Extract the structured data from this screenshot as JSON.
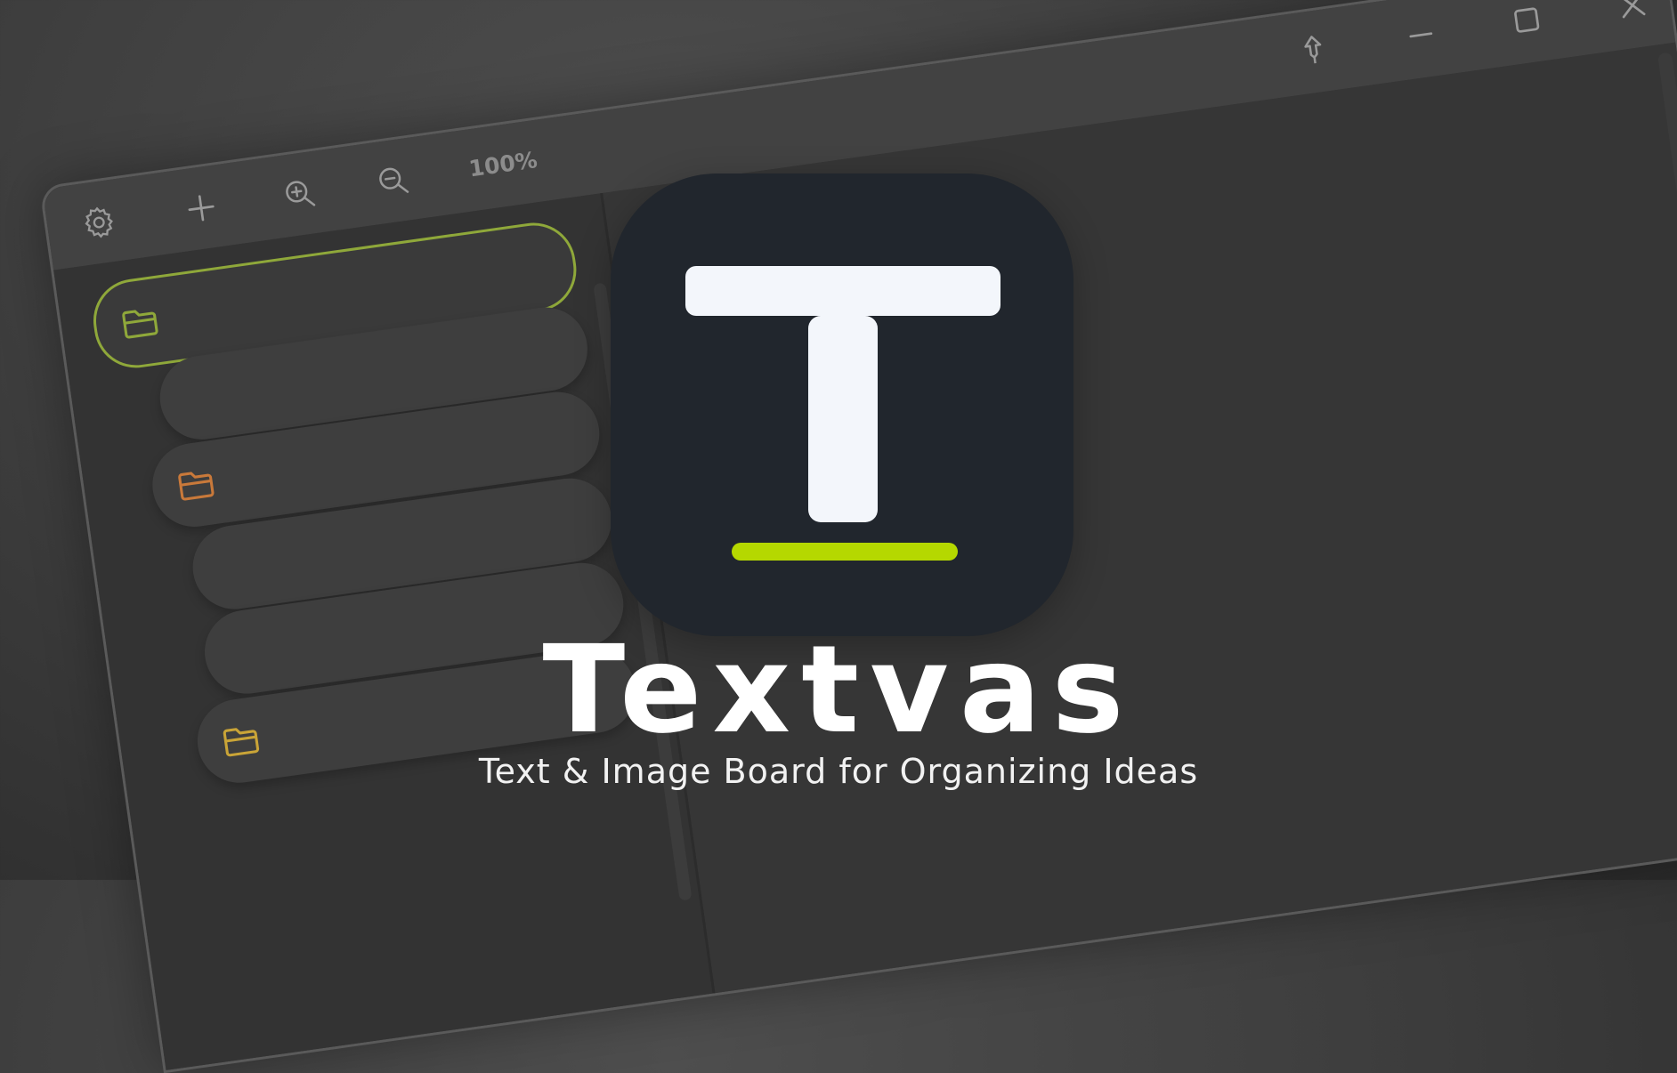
{
  "toolbar": {
    "zoom_level": "100%"
  },
  "branding": {
    "app_name": "Textvas",
    "tagline": "Text & Image Board for Organizing Ideas"
  },
  "icons": {
    "settings": "gear-icon",
    "add": "plus-icon",
    "zoom_in": "zoom-in-icon",
    "zoom_out": "zoom-out-icon",
    "pin": "pin-icon",
    "minimize": "minimize-icon",
    "maximize": "maximize-icon",
    "close": "close-icon",
    "folder": "folder-icon"
  },
  "sidebar": {
    "items": [
      {
        "type": "folder",
        "folder_color": "#8fa83a",
        "selected": true
      },
      {
        "type": "note"
      },
      {
        "type": "folder",
        "folder_color": "#c9793a",
        "selected": false
      },
      {
        "type": "note"
      },
      {
        "type": "note"
      },
      {
        "type": "folder",
        "folder_color": "#c9a437",
        "selected": false
      }
    ]
  },
  "colors": {
    "accent": "#b5d800",
    "selected_outline": "#8fa83a",
    "logo_background": "#21262d",
    "logo_glyph": "#f3f6fb"
  }
}
